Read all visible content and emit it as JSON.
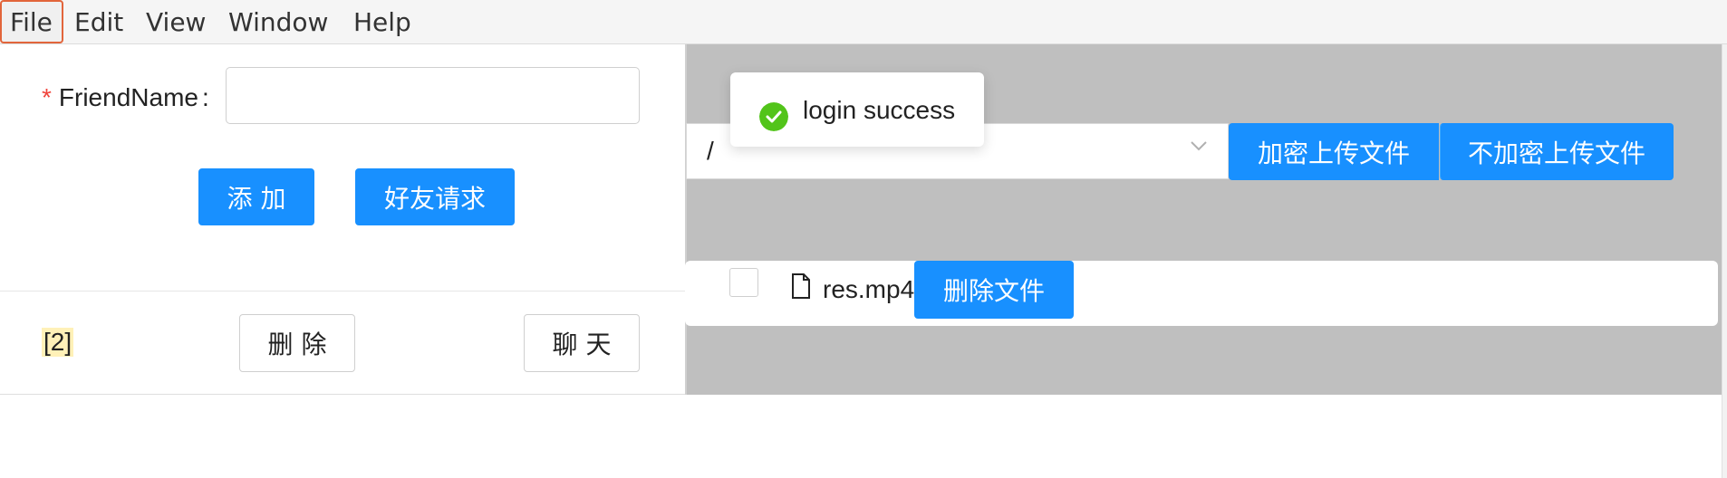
{
  "menubar": {
    "items": [
      "File",
      "Edit",
      "View",
      "Window",
      "Help"
    ]
  },
  "friend_form": {
    "required_mark": "*",
    "label": "FriendName",
    "colon": ":",
    "input_value": "",
    "add_button": "添 加",
    "requests_button": "好友请求"
  },
  "friend_list": {
    "count_badge": "[2]",
    "delete_button": "删 除",
    "chat_button": "聊 天"
  },
  "files": {
    "path_select_value": "/",
    "encrypt_upload_button": "加密上传文件",
    "plain_upload_button": "不加密上传文件",
    "rows": [
      {
        "name": "res.mp4",
        "delete_button": "删除文件",
        "checked": false
      }
    ]
  },
  "toast": {
    "message": "login success",
    "status": "success"
  },
  "colors": {
    "primary": "#1890ff",
    "success": "#52c41a",
    "required": "#f0443c",
    "menu_active_border": "#e2653b",
    "panel_gray": "#bfbfbf"
  },
  "icons": {
    "toast": "check-circle-icon",
    "file": "file-icon",
    "select": "chevron-down-icon"
  }
}
